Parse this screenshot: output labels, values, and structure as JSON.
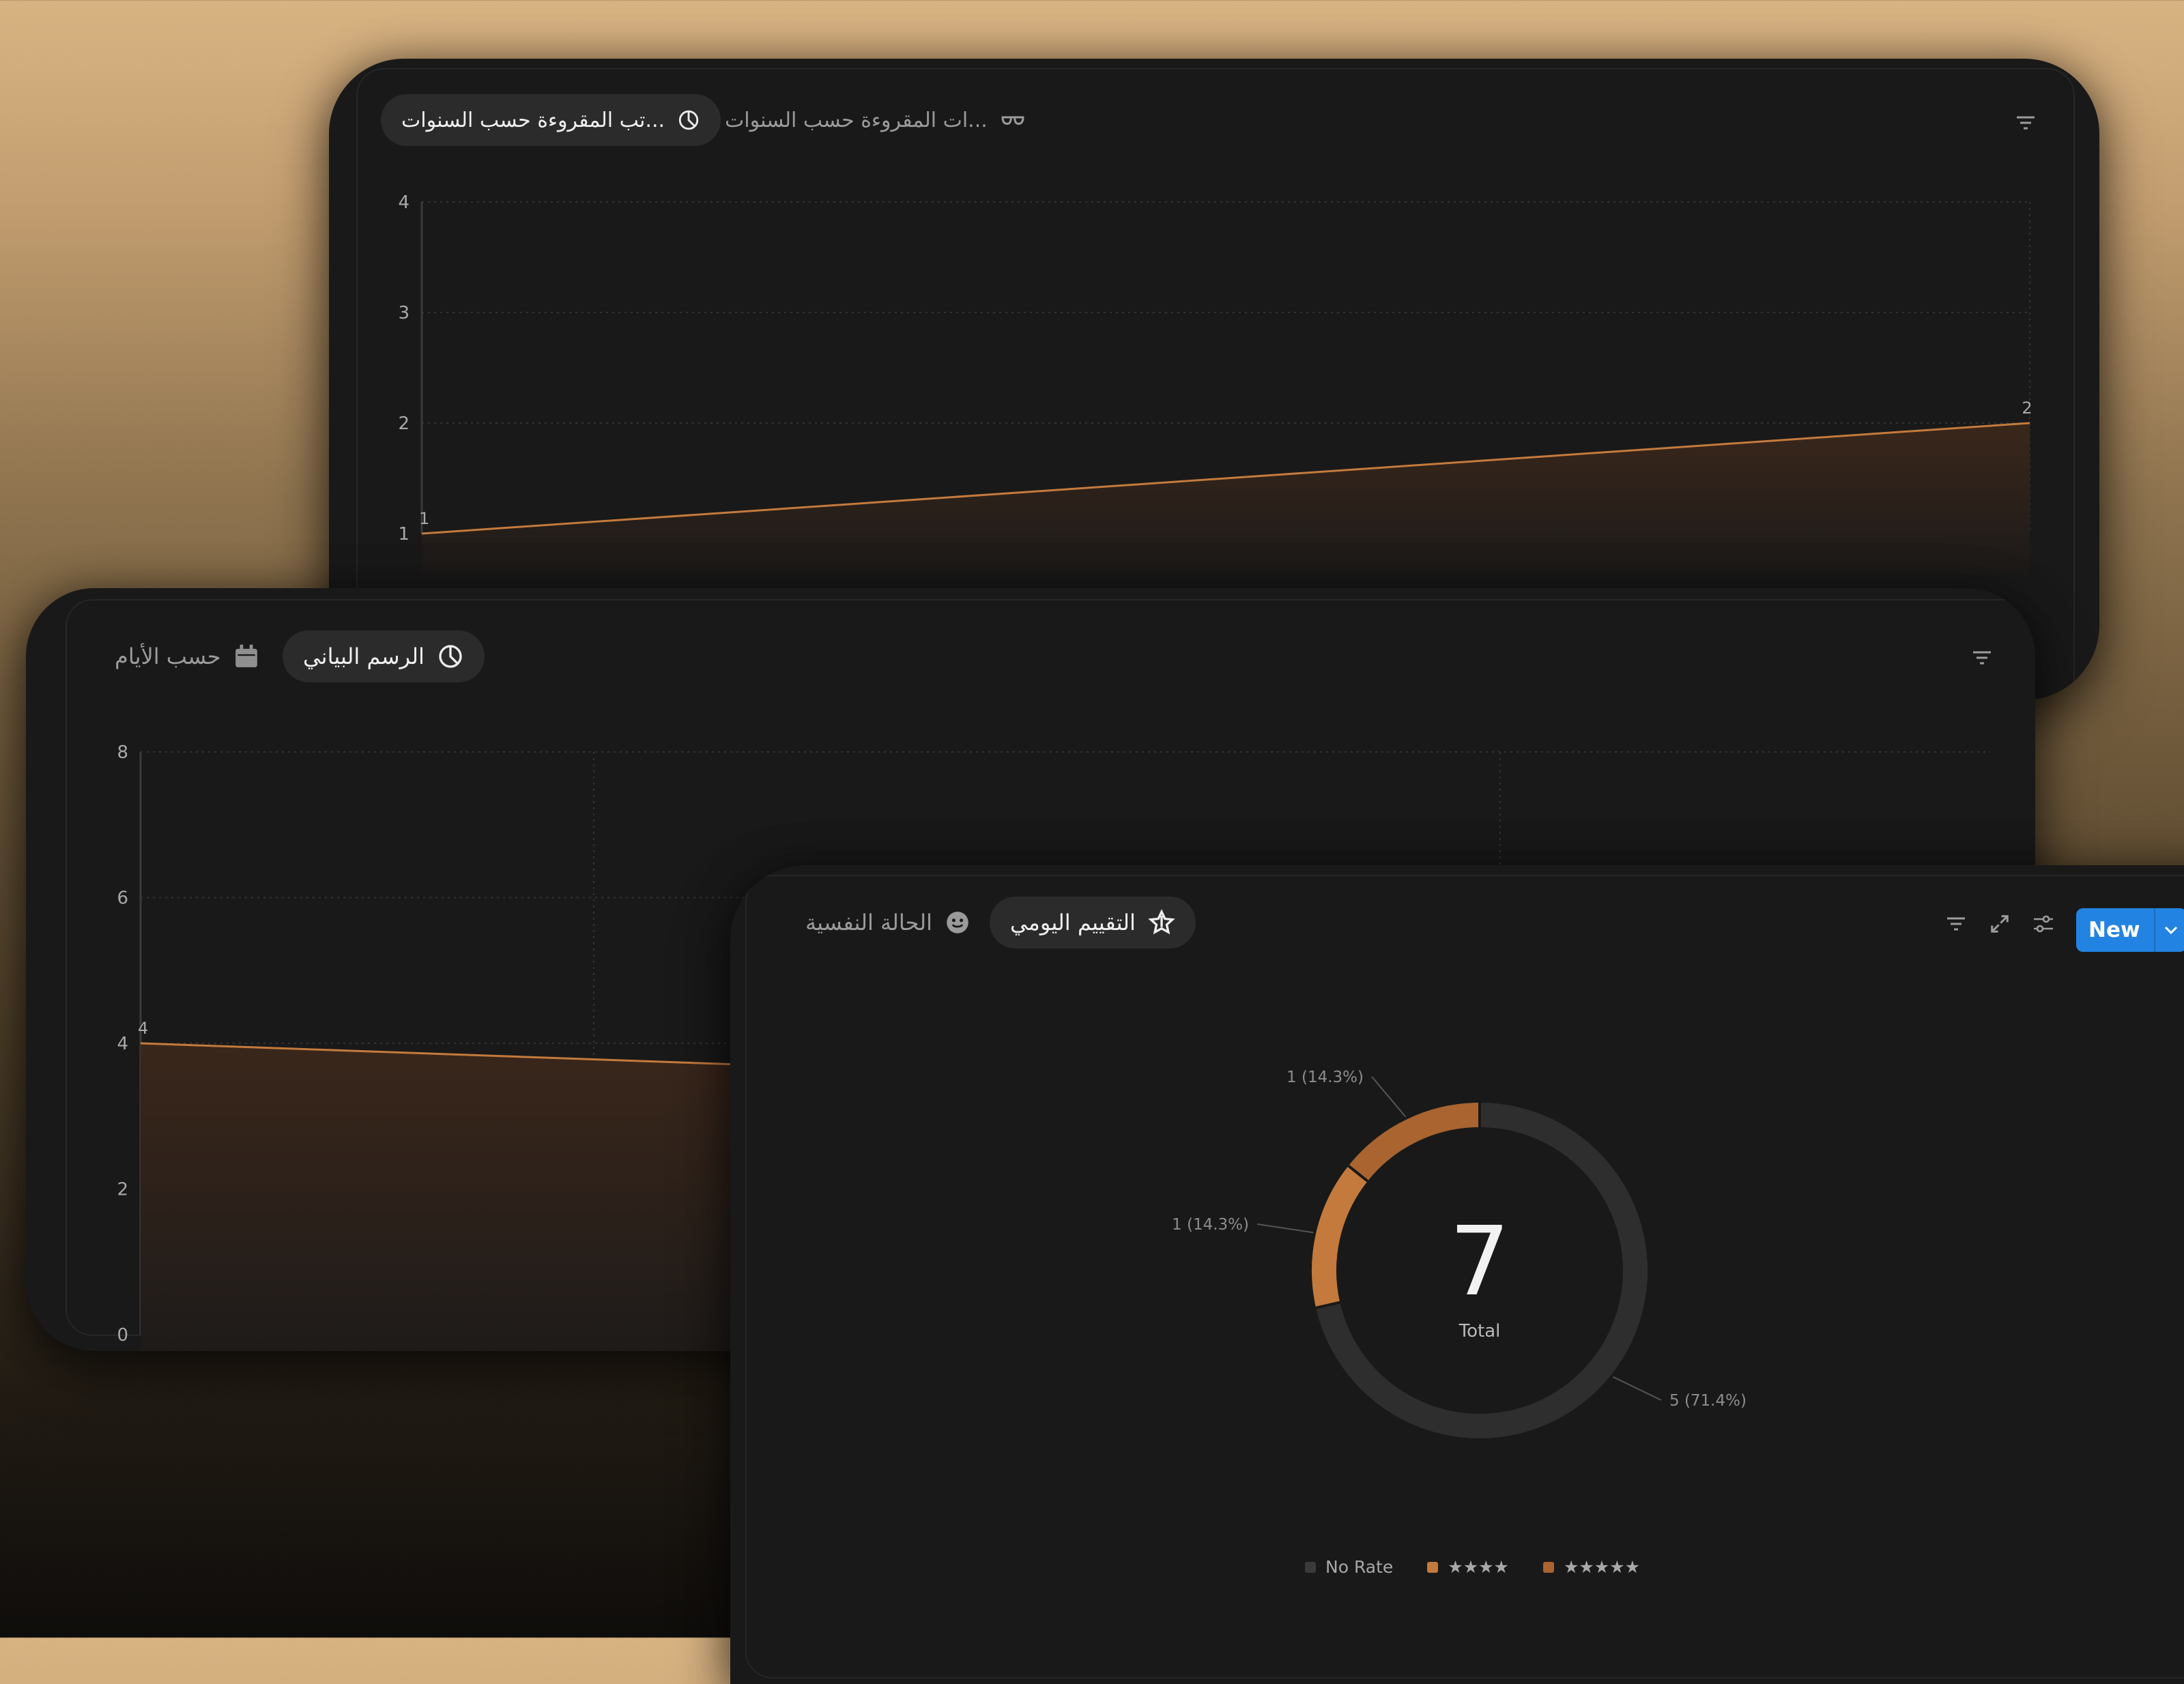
{
  "colors": {
    "accent": "#b56b32",
    "accent_light": "#c47a3c",
    "grid": "#333333",
    "panel_bg": "#191919",
    "no_rate": "#2e2e2e",
    "new_button": "#2383e2"
  },
  "top_panel": {
    "tabs": [
      {
        "label": "...تب المقروءة حسب السنوات",
        "icon": "pie-chart-icon",
        "active": true
      },
      {
        "label": "...ات المقروءة حسب السنوات",
        "icon": "glasses-icon",
        "active": false
      }
    ],
    "filter_icon": "filter-icon",
    "chart_data": {
      "type": "area",
      "x": [
        0,
        1
      ],
      "values": [
        1,
        2
      ],
      "data_labels": [
        "1",
        "2"
      ],
      "yticks": [
        "4",
        "3",
        "2",
        "1"
      ],
      "ylim": [
        1,
        4
      ],
      "grid": true,
      "xlabel": "",
      "ylabel": ""
    }
  },
  "mid_panel": {
    "tabs": [
      {
        "label": "الرسم البياني",
        "icon": "pie-chart-icon",
        "active": true
      },
      {
        "label": "حسب الأيام",
        "icon": "calendar-icon",
        "active": false
      }
    ],
    "filter_icon": "filter-icon",
    "chart_data": {
      "type": "area",
      "x": [
        0,
        1,
        2,
        3
      ],
      "values": [
        4,
        3.7,
        3.4,
        3.1
      ],
      "data_labels": [
        "4"
      ],
      "yticks": [
        "8",
        "6",
        "4",
        "2",
        "0"
      ],
      "ylim": [
        0,
        8
      ],
      "grid": true,
      "xlabel": "",
      "ylabel": ""
    }
  },
  "bottom_panel": {
    "tabs": [
      {
        "label": "التقييم اليومي",
        "icon": "star-icon",
        "active": true
      },
      {
        "label": "الحالة النفسية",
        "icon": "smiley-icon",
        "active": false
      }
    ],
    "toolbar": {
      "filter_icon": "filter-icon",
      "expand_icon": "expand-icon",
      "settings_icon": "sliders-icon",
      "new_label": "New"
    },
    "chart_data": {
      "type": "pie",
      "categories": [
        "No Rate",
        "★★★★",
        "★★★★★"
      ],
      "values": [
        5,
        1,
        1
      ],
      "slice_labels": [
        "5 (71.4%)",
        "1 (14.3%)",
        "1 (14.3%)"
      ],
      "total_value": "7",
      "total_label": "Total",
      "legend_position": "bottom"
    }
  }
}
